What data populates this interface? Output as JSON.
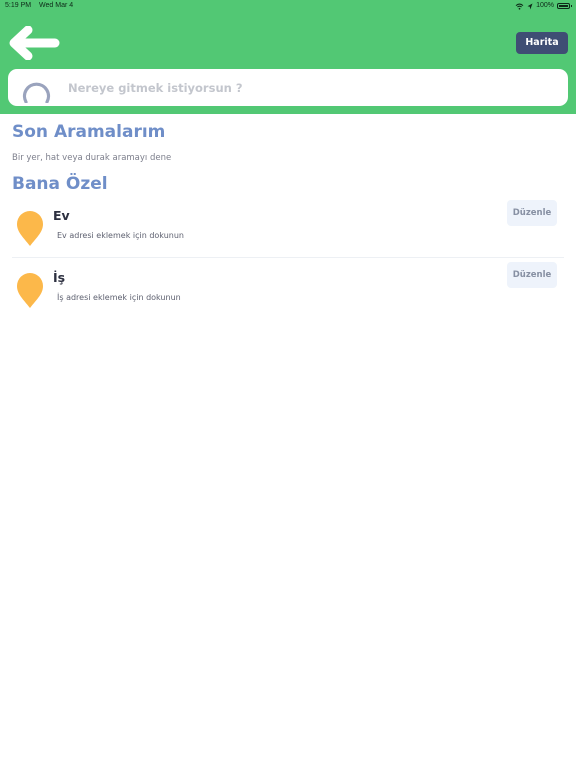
{
  "status_bar": {
    "time": "5:19 PM",
    "date": "Wed Mar 4",
    "battery": "100%",
    "icons": [
      "wifi-icon",
      "location-arrow-icon",
      "battery-icon"
    ]
  },
  "header": {
    "back_icon": "back-arrow-icon",
    "map_button_label": "Harita"
  },
  "search": {
    "icon": "search-icon",
    "placeholder": "Nereye gitmek istiyorsun ?"
  },
  "recent": {
    "title": "Son Aramalarım",
    "hint": "Bir yer, hat veya durak aramayı dene"
  },
  "favorites": {
    "title": "Bana Özel",
    "items": [
      {
        "icon": "location-pin-icon",
        "title": "Ev",
        "subtitle": "Ev adresi eklemek için dokunun",
        "edit_label": "Düzenle"
      },
      {
        "icon": "location-pin-icon",
        "title": "İş",
        "subtitle": "İş adresi eklemek için dokunun",
        "edit_label": "Düzenle"
      }
    ]
  },
  "colors": {
    "header_green": "#52c874",
    "map_button": "#3f4e74",
    "section_title": "#6f8ec8",
    "pin": "#fcb84a",
    "edit_button_bg": "#eef3fb"
  }
}
